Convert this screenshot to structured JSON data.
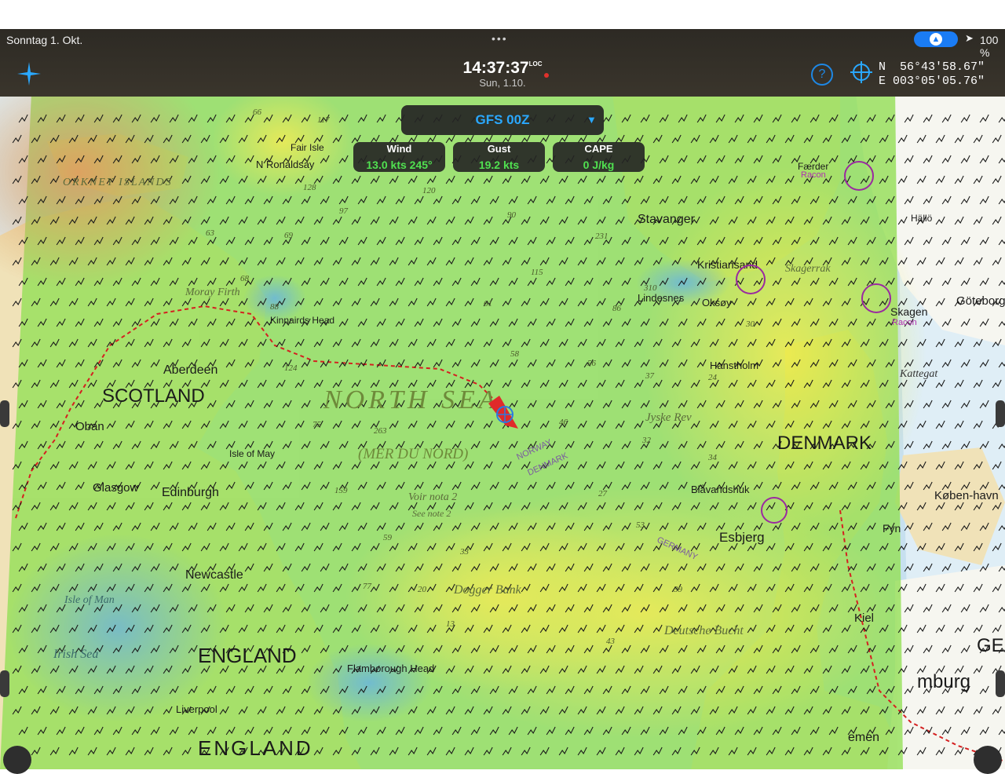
{
  "status_bar": {
    "date": "Sonntag 1. Okt.",
    "battery": "100 %",
    "dots": "•••"
  },
  "header": {
    "time": "14:37:37",
    "time_suffix": "LOC",
    "date": "Sun, 1.10.",
    "position_lat": "N  56°43'58.67\"",
    "position_lon": "E 003°05'05.76\"",
    "help_label": "?"
  },
  "weather": {
    "model": "GFS 00Z",
    "params": [
      {
        "label": "Wind",
        "value": "13.0 kts 245°"
      },
      {
        "label": "Gust",
        "value": "19.2 kts"
      },
      {
        "label": "CAPE",
        "value": "0 J/kg"
      }
    ]
  },
  "map": {
    "labels": {
      "north_sea": "NORTH SEA",
      "mer_du_nord": "(MER DU NORD)",
      "voir_nota": "Voir nota 2",
      "see_note": "See note 2",
      "scotland": "SCOTLAND",
      "england": "ENGLAND",
      "england2": "ENGLAND",
      "denmark": "DENMARK",
      "aberdeen": "Aberdeen",
      "oban": "Oban",
      "glasgow": "Glasgow",
      "edinburgh": "Edinburgh",
      "newcastle": "Newcastle",
      "liverpool": "Liverpool",
      "isle_of_man": "Isle of Man",
      "irish_sea": "Irish Sea",
      "stavanger": "Stavanger",
      "kristiansand": "Kristiansand",
      "lindesnes": "Lindesnes",
      "oksoy": "Oksøy",
      "skagerrak": "Skagerrak",
      "skagen": "Skagen",
      "goteborg": "Göteborg",
      "kattegat": "Kattegat",
      "esbjerg": "Esbjerg",
      "blavandshuk": "Blåvandshuk",
      "hanstholm": "Hanstholm",
      "jyske_rev": "Jyske Rev",
      "dogger_bank": "Dogger Bank",
      "deutsche_bucht": "Deutsche Bucht",
      "flamborough": "Flamborough Head",
      "kinnairds": "Kinnairds Head",
      "moray_firth": "Moray Firth",
      "orkney": "ORKNEY ISLANDS",
      "n_ronaldsay": "N Ronaldsay",
      "fair_isle": "Fair Isle",
      "kiel": "Kiel",
      "fyn": "Fyn",
      "kobenhavn": "Køben-havn",
      "hamburg": "mburg",
      "bremen": "emen",
      "ge": "GE",
      "hallo": "Hällö",
      "faerder": "Færder",
      "racon": "Racon",
      "isle_of_may": "Isle of May",
      "norway": "NORWAY",
      "denmark_line": "DENMARK",
      "germany": "GERMANY"
    },
    "soundings": [
      "66",
      "117",
      "128",
      "120",
      "97",
      "90",
      "69",
      "231",
      "115",
      "61",
      "310",
      "86",
      "88",
      "58",
      "124",
      "56",
      "37",
      "24",
      "75",
      "263",
      "46",
      "32",
      "34",
      "159",
      "27",
      "53",
      "59",
      "33",
      "77",
      "20",
      "39",
      "43",
      "13",
      "63",
      "68",
      "30"
    ]
  }
}
